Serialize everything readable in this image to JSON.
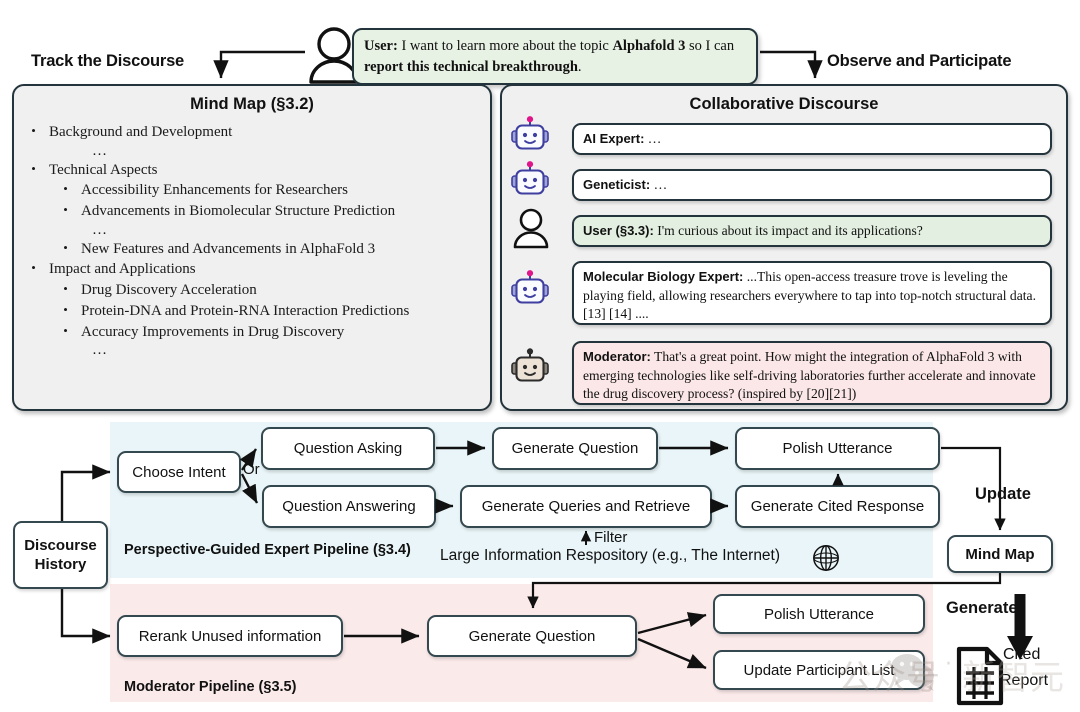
{
  "figure": {
    "labels": {
      "track_discourse": "Track the Discourse",
      "observe_participate": "Observe and Participate",
      "update": "Update",
      "generate": "Generate",
      "or": "Or",
      "filter": "Filter",
      "repository": "Large Information Respository (e.g., The Internet)",
      "cited_report_line1": "Cited",
      "cited_report_line2": "Report"
    },
    "user_prompt": {
      "speaker": "User:",
      "text_1": " I want to learn more about the topic ",
      "bold_1": "Alphafold 3",
      "text_2": " so I can ",
      "bold_2": "report this technical breakthrough",
      "text_3": "."
    },
    "mind_map_panel": {
      "title": "Mind Map (§3.2)",
      "items": [
        {
          "level": 1,
          "text": "Background and Development"
        },
        {
          "level": 0,
          "text": "…"
        },
        {
          "level": 1,
          "text": "Technical Aspects"
        },
        {
          "level": 2,
          "text": "Accessibility Enhancements for Researchers"
        },
        {
          "level": 2,
          "text": "Advancements in Biomolecular Structure Prediction"
        },
        {
          "level": 0,
          "text": "…"
        },
        {
          "level": 2,
          "text": "New Features and Advancements in AlphaFold 3"
        },
        {
          "level": 1,
          "text": "Impact and Applications"
        },
        {
          "level": 2,
          "text": "Drug Discovery Acceleration"
        },
        {
          "level": 2,
          "text": "Protein-DNA and Protein-RNA Interaction Predictions"
        },
        {
          "level": 2,
          "text": "Accuracy Improvements in Drug Discovery"
        },
        {
          "level": 0,
          "text": "…"
        }
      ]
    },
    "discourse_panel": {
      "title": "Collaborative Discourse",
      "messages": [
        {
          "avatar": "robot-blue",
          "speaker": "AI Expert:",
          "text": " …",
          "tone": "white"
        },
        {
          "avatar": "robot-blue",
          "speaker": "Geneticist:",
          "text": " …",
          "tone": "white"
        },
        {
          "avatar": "user",
          "speaker": "User (§3.3):",
          "text": " I'm curious about its impact and its applications?",
          "tone": "green"
        },
        {
          "avatar": "robot-blue",
          "speaker": "Molecular Biology Expert:",
          "text": " ...This open-access treasure trove is leveling the playing field, allowing researchers everywhere to tap into top-notch structural data.[13] [14] ....",
          "tone": "white"
        },
        {
          "avatar": "robot-tan",
          "speaker": "Moderator:",
          "text": " That's a great point. How might the integration of AlphaFold 3 with emerging technologies like self-driving laboratories further accelerate and innovate the drug discovery process? (inspired by [20][21])",
          "tone": "pink"
        }
      ]
    },
    "pipelines": {
      "expert": {
        "caption": "Perspective-Guided Expert Pipeline (§3.4)",
        "nodes": {
          "choose_intent": "Choose Intent",
          "question_asking": "Question Asking",
          "question_answering": "Question Answering",
          "generate_question": "Generate Question",
          "generate_queries": "Generate Queries and Retrieve",
          "polish_utterance": "Polish Utterance",
          "generate_cited_response": "Generate Cited Response"
        }
      },
      "moderator": {
        "caption": "Moderator Pipeline (§3.5)",
        "nodes": {
          "rerank": "Rerank Unused information",
          "generate_question": "Generate Question",
          "polish_utterance": "Polish Utterance",
          "update_participants": "Update Participant List"
        }
      },
      "shared": {
        "discourse_history_l1": "Discourse",
        "discourse_history_l2": "History",
        "mind_map": "Mind Map"
      }
    },
    "watermark": {
      "text": "公众号",
      "dot": "·"
    },
    "colors": {
      "outline": "#24343c",
      "node_outline": "#34484f",
      "panel_bg": "#f0f0f0",
      "expert_region": "#e9f5f8",
      "moderator_region": "#fbeaea",
      "user_bubble": "#e8f2e4",
      "moderator_bubble": "#fbe7e7",
      "robot_blue": "#3f3fa0",
      "robot_antenna": "#e0158a",
      "robot_tan": "#ece2d5"
    }
  }
}
